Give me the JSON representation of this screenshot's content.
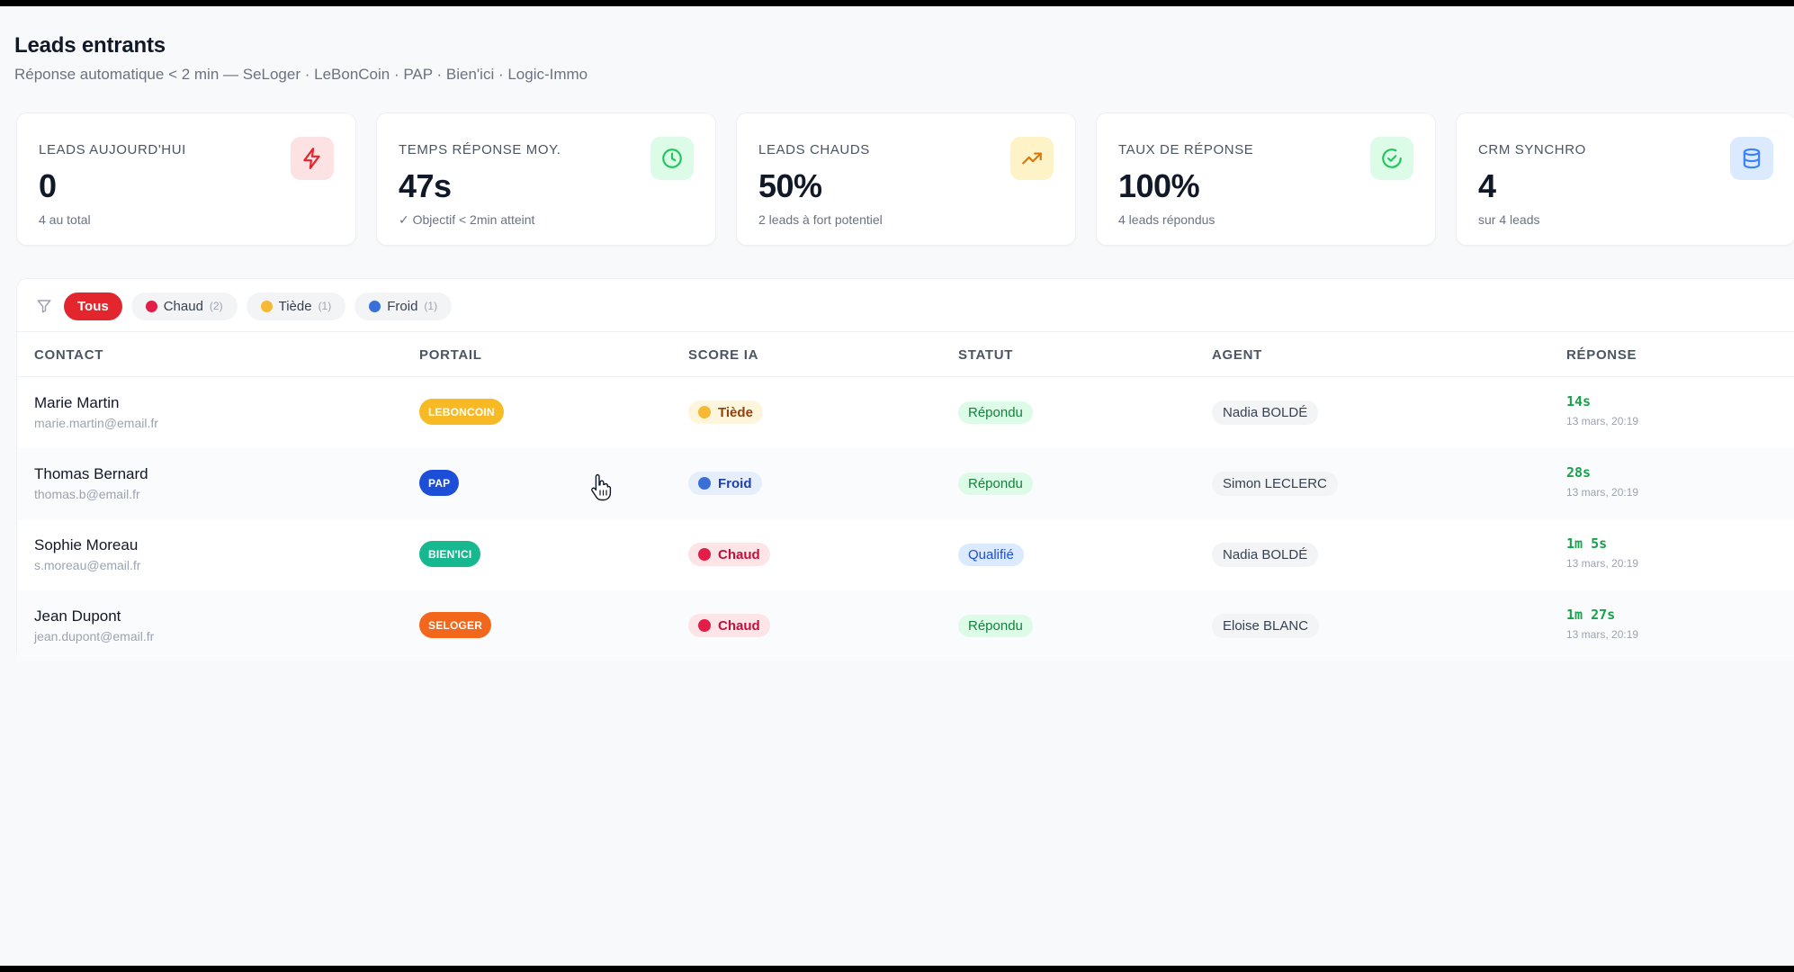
{
  "header": {
    "title": "Leads entrants",
    "subtitle": "Réponse automatique < 2 min — SeLoger · LeBonCoin · PAP · Bien'ici · Logic-Immo"
  },
  "stats": [
    {
      "label": "LEADS AUJOURD'HUI",
      "value": "0",
      "note": "4 au total",
      "icon": "lightning-icon",
      "icon_bg": "#fde2e4",
      "icon_color": "#e3262d"
    },
    {
      "label": "TEMPS RÉPONSE MOY.",
      "value": "47s",
      "note": "✓ Objectif < 2min atteint",
      "icon": "clock-icon",
      "icon_bg": "#dcfce7",
      "icon_color": "#22c55e"
    },
    {
      "label": "LEADS CHAUDS",
      "value": "50%",
      "note": "2 leads à fort potentiel",
      "icon": "trending-up-icon",
      "icon_bg": "#fef3c7",
      "icon_color": "#d97706"
    },
    {
      "label": "TAUX DE RÉPONSE",
      "value": "100%",
      "note": "4 leads répondus",
      "icon": "check-circle-icon",
      "icon_bg": "#dcfce7",
      "icon_color": "#22c55e"
    },
    {
      "label": "CRM SYNCHRO",
      "value": "4",
      "note": "sur 4 leads",
      "icon": "database-icon",
      "icon_bg": "#dbeafe",
      "icon_color": "#3b82f6"
    }
  ],
  "filters": {
    "icon": "filter-icon",
    "items": [
      {
        "label": "Tous",
        "count": "",
        "dot": "",
        "active": true
      },
      {
        "label": "Chaud",
        "count": "(2)",
        "dot": "#e11d48",
        "active": false
      },
      {
        "label": "Tiède",
        "count": "(1)",
        "dot": "#f5b935",
        "active": false
      },
      {
        "label": "Froid",
        "count": "(1)",
        "dot": "#3b6fd8",
        "active": false
      }
    ]
  },
  "table": {
    "columns": [
      "CONTACT",
      "PORTAIL",
      "SCORE IA",
      "STATUT",
      "AGENT",
      "RÉPONSE"
    ],
    "rows": [
      {
        "name": "Marie Martin",
        "email": "marie.martin@email.fr",
        "portal": "LEBONCOIN",
        "portal_color": "#f7b924",
        "score": "Tiède",
        "score_dot": "#f5b935",
        "score_bg": "#fef6dc",
        "score_color": "#92400e",
        "status": "Répondu",
        "status_bg": "#dcfce7",
        "status_color": "#15803d",
        "agent": "Nadia BOLDÉ",
        "resp_time": "14s",
        "resp_date": "13 mars, 20:19"
      },
      {
        "name": "Thomas Bernard",
        "email": "thomas.b@email.fr",
        "portal": "PAP",
        "portal_color": "#1d4ed8",
        "score": "Froid",
        "score_dot": "#3b6fd8",
        "score_bg": "#e6eefc",
        "score_color": "#1e40af",
        "status": "Répondu",
        "status_bg": "#dcfce7",
        "status_color": "#15803d",
        "agent": "Simon LECLERC",
        "resp_time": "28s",
        "resp_date": "13 mars, 20:19"
      },
      {
        "name": "Sophie Moreau",
        "email": "s.moreau@email.fr",
        "portal": "BIEN'ICI",
        "portal_color": "#17b890",
        "score": "Chaud",
        "score_dot": "#e11d48",
        "score_bg": "#fde4e7",
        "score_color": "#be123c",
        "status": "Qualifié",
        "status_bg": "#dbeafe",
        "status_color": "#1d4ed8",
        "agent": "Nadia BOLDÉ",
        "resp_time": "1m 5s",
        "resp_date": "13 mars, 20:19"
      },
      {
        "name": "Jean Dupont",
        "email": "jean.dupont@email.fr",
        "portal": "SELOGER",
        "portal_color": "#f2671b",
        "score": "Chaud",
        "score_dot": "#e11d48",
        "score_bg": "#fde4e7",
        "score_color": "#be123c",
        "status": "Répondu",
        "status_bg": "#dcfce7",
        "status_color": "#15803d",
        "agent": "Eloise BLANC",
        "resp_time": "1m 27s",
        "resp_date": "13 mars, 20:19"
      }
    ]
  },
  "cursor": "hand-pointer-icon"
}
